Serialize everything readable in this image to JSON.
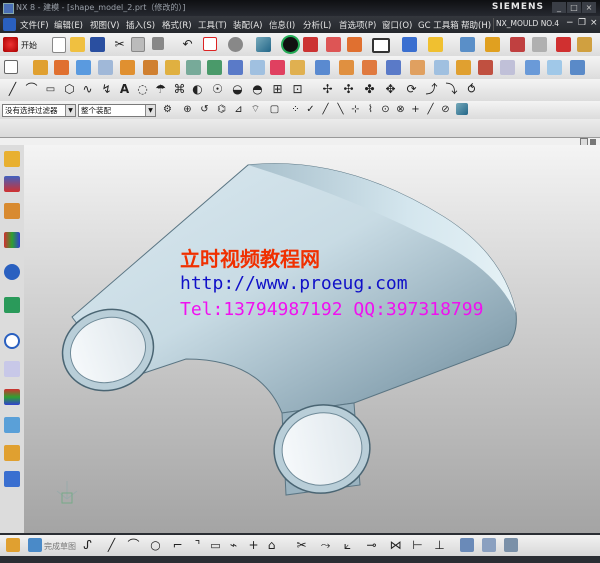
{
  "window": {
    "title": "NX 8 - 建模 - [shape_model_2.prt（修改的）]",
    "brand": "SIEMENS",
    "controls": [
      "_",
      "□",
      "×"
    ]
  },
  "menu": {
    "items": [
      "文件(F)",
      "编辑(E)",
      "视图(V)",
      "插入(S)",
      "格式(R)",
      "工具(T)",
      "装配(A)",
      "信息(I)",
      "分析(L)",
      "首选项(P)",
      "窗口(O)",
      "GC 工具箱",
      "帮助(H)",
      "NX_MOULD NO.4"
    ]
  },
  "toolbar1": {
    "start_label": "开始"
  },
  "selection_bar": {
    "filter_value": "没有选择过滤器",
    "scope_value": "整个装配"
  },
  "watermark": {
    "line1": "立时视频教程网",
    "line2": "http://www.proeug.com",
    "line3": "Tel:13794987192  QQ:397318799"
  },
  "sketch_bar": {
    "finish_label": "完成草图"
  },
  "colors": {
    "menubar": "#2c2f35",
    "toolbar": "#e6e6e6",
    "viewport_top": "#f4f4f4",
    "viewport_bottom": "#a4a4a4",
    "model": "#9fb9c6",
    "watermark_red": "#f03000",
    "watermark_blue": "#1010c8",
    "watermark_magenta": "#f010f0"
  }
}
